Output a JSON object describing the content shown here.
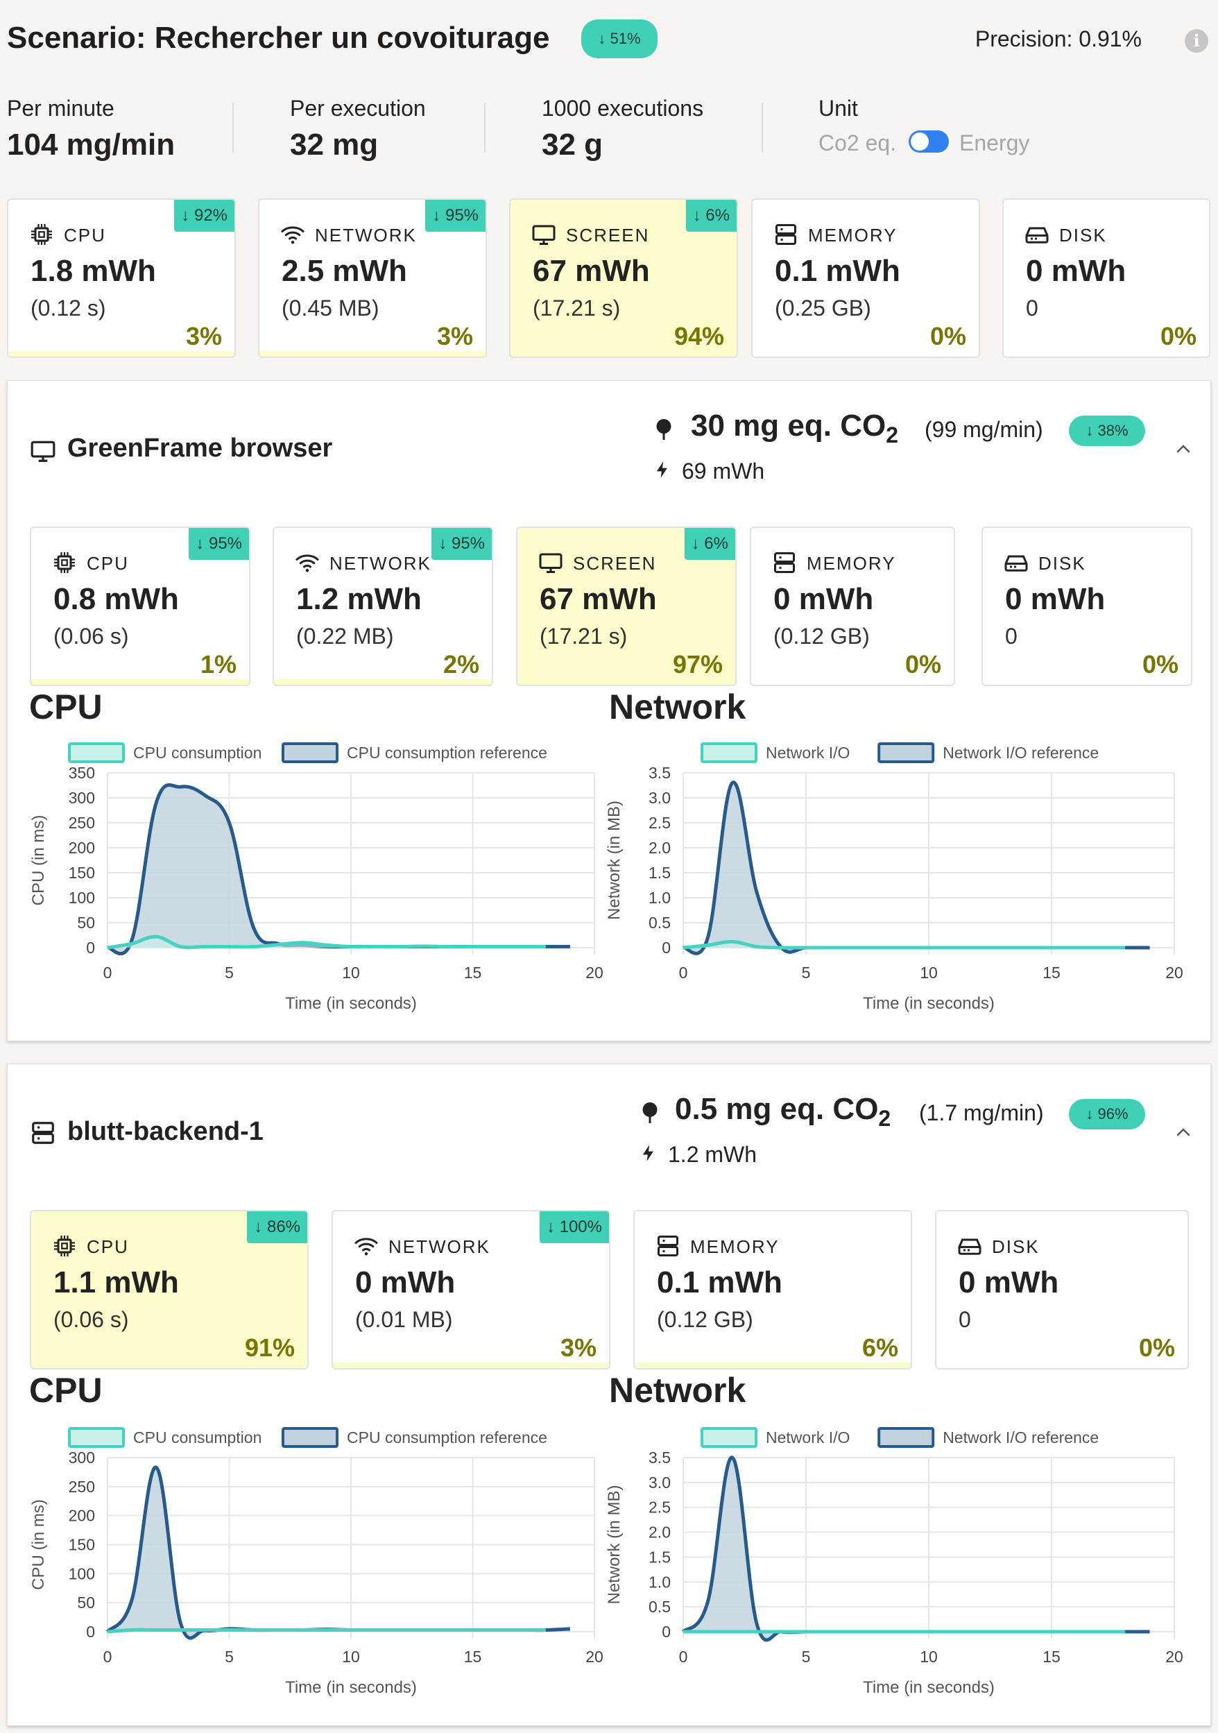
{
  "header": {
    "title": "Scenario: Rechercher un covoiturage",
    "title_badge": "↓ 51%",
    "precision": "Precision: 0.91%",
    "info_icon": "i",
    "stats": [
      {
        "label": "Per minute",
        "value": "104 mg/min"
      },
      {
        "label": "Per execution",
        "value": "32 mg"
      },
      {
        "label": "1000 executions",
        "value": "32 g"
      }
    ],
    "unit": {
      "label": "Unit",
      "left": "Co2 eq.",
      "right": "Energy",
      "toggle_on": true
    }
  },
  "summary_cards": [
    {
      "icon": "cpu-icon",
      "label": "CPU",
      "value": "1.8 mWh",
      "sub": "(0.12 s)",
      "pct": "3%",
      "share": 0.03,
      "badge": "↓ 92%",
      "highlight": false
    },
    {
      "icon": "wifi-icon",
      "label": "NETWORK",
      "value": "2.5 mWh",
      "sub": "(0.45 MB)",
      "pct": "3%",
      "share": 0.03,
      "badge": "↓ 95%",
      "highlight": false
    },
    {
      "icon": "monitor-icon",
      "label": "SCREEN",
      "value": "67 mWh",
      "sub": "(17.21 s)",
      "pct": "94%",
      "share": 0.94,
      "badge": "↓ 6%",
      "highlight": true
    },
    {
      "icon": "memory-icon",
      "label": "MEMORY",
      "value": "0.1 mWh",
      "sub": "(0.25 GB)",
      "pct": "0%",
      "share": 0,
      "badge": "",
      "highlight": false
    },
    {
      "icon": "disk-icon",
      "label": "DISK",
      "value": "0 mWh",
      "sub": "0",
      "pct": "0%",
      "share": 0,
      "badge": "",
      "highlight": false
    }
  ],
  "containers": [
    {
      "icon": "monitor-icon",
      "name": "GreenFrame browser",
      "co2_value": "30 mg eq. CO",
      "co2_sub": "2",
      "co2_rate": "(99 mg/min)",
      "badge": "↓ 38%",
      "energy": "69 mWh",
      "cards": [
        {
          "icon": "cpu-icon",
          "label": "CPU",
          "value": "0.8 mWh",
          "sub": "(0.06 s)",
          "pct": "1%",
          "share": 0.01,
          "badge": "↓ 95%",
          "highlight": false
        },
        {
          "icon": "wifi-icon",
          "label": "NETWORK",
          "value": "1.2 mWh",
          "sub": "(0.22 MB)",
          "pct": "2%",
          "share": 0.02,
          "badge": "↓ 95%",
          "highlight": false
        },
        {
          "icon": "monitor-icon",
          "label": "SCREEN",
          "value": "67 mWh",
          "sub": "(17.21 s)",
          "pct": "97%",
          "share": 0.97,
          "badge": "↓ 6%",
          "highlight": true
        },
        {
          "icon": "memory-icon",
          "label": "MEMORY",
          "value": "0 mWh",
          "sub": "(0.12 GB)",
          "pct": "0%",
          "share": 0,
          "badge": "",
          "highlight": false
        },
        {
          "icon": "disk-icon",
          "label": "DISK",
          "value": "0 mWh",
          "sub": "0",
          "pct": "0%",
          "share": 0,
          "badge": "",
          "highlight": false
        }
      ]
    },
    {
      "icon": "server-icon",
      "name": "blutt-backend-1",
      "co2_value": "0.5 mg eq. CO",
      "co2_sub": "2",
      "co2_rate": "(1.7 mg/min)",
      "badge": "↓ 96%",
      "energy": "1.2 mWh",
      "cards": [
        {
          "icon": "cpu-icon",
          "label": "CPU",
          "value": "1.1 mWh",
          "sub": "(0.06 s)",
          "pct": "91%",
          "share": 0.91,
          "badge": "↓ 86%",
          "highlight": true
        },
        {
          "icon": "wifi-icon",
          "label": "NETWORK",
          "value": "0 mWh",
          "sub": "(0.01 MB)",
          "pct": "3%",
          "share": 0.03,
          "badge": "↓ 100%",
          "highlight": false
        },
        {
          "icon": "memory-icon",
          "label": "MEMORY",
          "value": "0.1 mWh",
          "sub": "(0.12 GB)",
          "pct": "6%",
          "share": 0.06,
          "badge": "",
          "highlight": false
        },
        {
          "icon": "disk-icon",
          "label": "DISK",
          "value": "0 mWh",
          "sub": "0",
          "pct": "0%",
          "share": 0,
          "badge": "",
          "highlight": false
        }
      ]
    }
  ],
  "colors": {
    "accent": "#3fd0b6",
    "reference": "#2a5a8a",
    "reference_fill": "#c3d3de",
    "highlight": "#fcfccc",
    "pct_text": "#767600",
    "toggle": "#2f82f0"
  },
  "chart_data": [
    {
      "type": "area",
      "title": "CPU",
      "xlabel": "Time (in seconds)",
      "ylabel": "CPU (in ms)",
      "xlim": [
        0,
        20
      ],
      "ylim": [
        0,
        350
      ],
      "xticks": [
        0,
        5,
        10,
        15,
        20
      ],
      "yticks": [
        0,
        50,
        100,
        150,
        200,
        250,
        300,
        350
      ],
      "series": [
        {
          "name": "CPU consumption",
          "x": [
            0,
            1,
            2,
            3,
            4,
            5,
            6,
            7,
            8,
            9,
            10,
            11,
            12,
            13,
            14,
            15,
            16,
            17,
            18
          ],
          "values": [
            0,
            8,
            22,
            2,
            2,
            2,
            2,
            6,
            10,
            5,
            2,
            2,
            2,
            3,
            2,
            2,
            2,
            2,
            2
          ]
        },
        {
          "name": "CPU consumption reference",
          "x": [
            0,
            1,
            2,
            3,
            4,
            5,
            6,
            7,
            8,
            9,
            10,
            11,
            12,
            13,
            14,
            15,
            16,
            17,
            18,
            19
          ],
          "values": [
            0,
            15,
            290,
            322,
            305,
            250,
            40,
            8,
            5,
            2,
            2,
            2,
            2,
            2,
            2,
            2,
            2,
            2,
            2,
            2
          ]
        }
      ]
    },
    {
      "type": "area",
      "title": "Network",
      "xlabel": "Time (in seconds)",
      "ylabel": "Network (in MB)",
      "xlim": [
        0,
        20
      ],
      "ylim": [
        0,
        3.5
      ],
      "xticks": [
        0,
        5,
        10,
        15,
        20
      ],
      "yticks": [
        0,
        0.5,
        1.0,
        1.5,
        2.0,
        2.5,
        3.0,
        3.5
      ],
      "ytick_labels": [
        "0",
        "0.5",
        "1.0",
        "1.5",
        "2.0",
        "2.5",
        "3.0",
        "3.5"
      ],
      "series": [
        {
          "name": "Network I/O",
          "x": [
            0,
            1,
            2,
            3,
            4,
            5,
            6,
            7,
            8,
            9,
            10,
            11,
            12,
            13,
            14,
            15,
            16,
            17,
            18
          ],
          "values": [
            0,
            0.05,
            0.12,
            0.02,
            0,
            0,
            0,
            0,
            0,
            0,
            0,
            0,
            0,
            0,
            0,
            0,
            0,
            0,
            0
          ]
        },
        {
          "name": "Network I/O reference",
          "x": [
            0,
            1,
            2,
            3,
            4,
            5,
            6,
            7,
            8,
            9,
            10,
            11,
            12,
            13,
            14,
            15,
            16,
            17,
            18,
            19
          ],
          "values": [
            0,
            0.2,
            3.3,
            1.1,
            0,
            0,
            0,
            0,
            0,
            0,
            0,
            0,
            0,
            0,
            0,
            0,
            0,
            0,
            0,
            0
          ]
        }
      ]
    },
    {
      "type": "area",
      "title": "CPU",
      "xlabel": "Time (in seconds)",
      "ylabel": "CPU (in ms)",
      "xlim": [
        0,
        20
      ],
      "ylim": [
        0,
        300
      ],
      "xticks": [
        0,
        5,
        10,
        15,
        20
      ],
      "yticks": [
        0,
        50,
        100,
        150,
        200,
        250,
        300
      ],
      "series": [
        {
          "name": "CPU consumption",
          "x": [
            0,
            1,
            2,
            3,
            4,
            5,
            6,
            7,
            8,
            9,
            10,
            11,
            12,
            13,
            14,
            15,
            16,
            17,
            18
          ],
          "values": [
            0,
            3,
            3,
            3,
            3,
            3,
            3,
            3,
            3,
            3,
            3,
            3,
            3,
            3,
            3,
            3,
            3,
            3,
            3
          ]
        },
        {
          "name": "CPU consumption reference",
          "x": [
            0,
            1,
            2,
            3,
            4,
            5,
            6,
            7,
            8,
            9,
            10,
            11,
            12,
            13,
            14,
            15,
            16,
            17,
            18,
            19
          ],
          "values": [
            0,
            55,
            283,
            15,
            2,
            5,
            3,
            3,
            3,
            4,
            3,
            3,
            3,
            3,
            3,
            3,
            3,
            3,
            3,
            5
          ]
        }
      ]
    },
    {
      "type": "area",
      "title": "Network",
      "xlabel": "Time (in seconds)",
      "ylabel": "Network (in MB)",
      "xlim": [
        0,
        20
      ],
      "ylim": [
        0,
        3.5
      ],
      "xticks": [
        0,
        5,
        10,
        15,
        20
      ],
      "yticks": [
        0,
        0.5,
        1.0,
        1.5,
        2.0,
        2.5,
        3.0,
        3.5
      ],
      "ytick_labels": [
        "0",
        "0.5",
        "1.0",
        "1.5",
        "2.0",
        "2.5",
        "3.0",
        "3.5"
      ],
      "series": [
        {
          "name": "Network I/O",
          "x": [
            0,
            1,
            2,
            3,
            4,
            5,
            6,
            7,
            8,
            9,
            10,
            11,
            12,
            13,
            14,
            15,
            16,
            17,
            18
          ],
          "values": [
            0,
            0,
            0,
            0,
            0,
            0,
            0,
            0,
            0,
            0,
            0,
            0,
            0,
            0,
            0,
            0,
            0,
            0,
            0
          ]
        },
        {
          "name": "Network I/O reference",
          "x": [
            0,
            1,
            2,
            3,
            4,
            5,
            6,
            7,
            8,
            9,
            10,
            11,
            12,
            13,
            14,
            15,
            16,
            17,
            18,
            19
          ],
          "values": [
            0,
            0.6,
            3.5,
            0.15,
            0,
            0,
            0,
            0,
            0,
            0,
            0,
            0,
            0,
            0,
            0,
            0,
            0,
            0,
            0,
            0
          ]
        }
      ]
    }
  ]
}
